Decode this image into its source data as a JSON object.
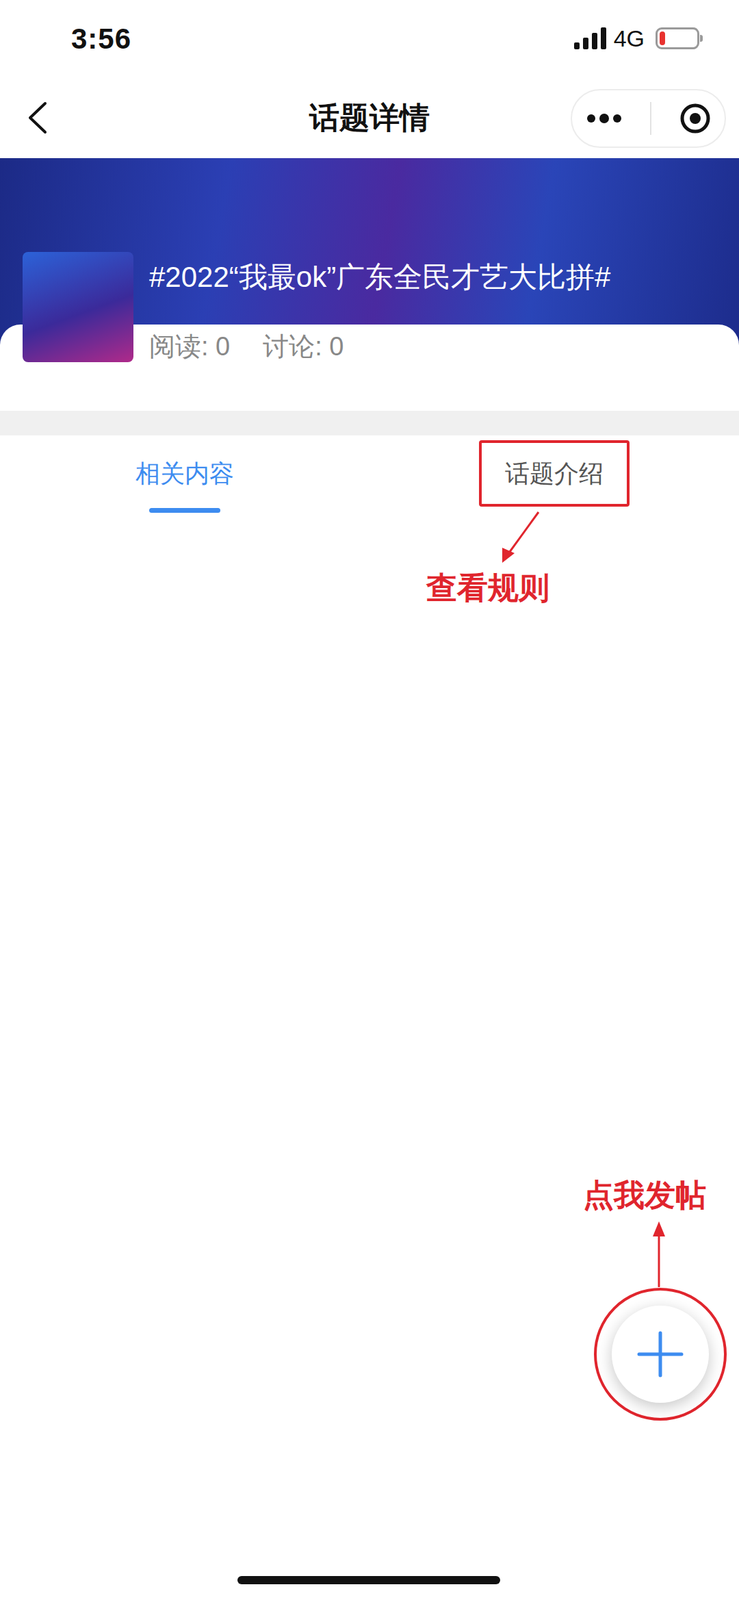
{
  "status_bar": {
    "time": "3:56",
    "network": "4G",
    "battery": {
      "level": 0.15,
      "low": true
    }
  },
  "nav": {
    "title": "话题详情"
  },
  "topic": {
    "title": "#2022“我最ok”广东全民才艺大比拼#",
    "stats": [
      "阅读: 0",
      "讨论: 0"
    ]
  },
  "tabs": [
    {
      "label": "相关内容",
      "selected": true,
      "annotated": false
    },
    {
      "label": "话题介绍",
      "selected": false,
      "annotated": true
    }
  ],
  "annotations": {
    "rules_hint": "查看规则",
    "post_hint": "点我发帖"
  }
}
